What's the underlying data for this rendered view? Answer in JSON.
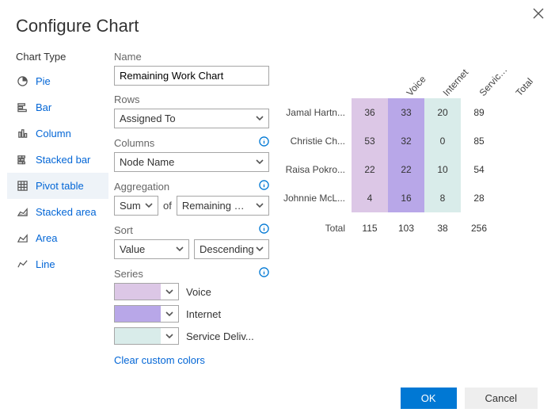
{
  "title": "Configure Chart",
  "sidebar": {
    "label": "Chart Type",
    "items": [
      {
        "label": "Pie"
      },
      {
        "label": "Bar"
      },
      {
        "label": "Column"
      },
      {
        "label": "Stacked bar"
      },
      {
        "label": "Pivot table"
      },
      {
        "label": "Stacked area"
      },
      {
        "label": "Area"
      },
      {
        "label": "Line"
      }
    ],
    "active": 4
  },
  "form": {
    "name_label": "Name",
    "name_value": "Remaining Work Chart",
    "rows_label": "Rows",
    "rows_value": "Assigned To",
    "columns_label": "Columns",
    "columns_value": "Node Name",
    "agg_label": "Aggregation",
    "agg_value": "Sum",
    "agg_of": "of",
    "agg_field": "Remaining Work",
    "sort_label": "Sort",
    "sort_field": "Value",
    "sort_order": "Descending",
    "series_label": "Series",
    "series": [
      {
        "label": "Voice",
        "color": "#dcc7e6"
      },
      {
        "label": "Internet",
        "color": "#b8a7e8"
      },
      {
        "label": "Service Deliv...",
        "color": "#d9ecea"
      }
    ],
    "clear_link": "Clear custom colors"
  },
  "chart_data": {
    "type": "table",
    "title": "Remaining Work Chart",
    "row_field": "Assigned To",
    "column_field": "Node Name",
    "aggregation": "Sum of Remaining Work",
    "columns": [
      "Voice",
      "Internet",
      "Service Del...",
      "Total"
    ],
    "column_colors": [
      "#dcc7e6",
      "#b8a7e8",
      "#d9ecea",
      null
    ],
    "rows": [
      {
        "label": "Jamal Hartn...",
        "values": [
          36,
          33,
          20,
          89
        ]
      },
      {
        "label": "Christie Ch...",
        "values": [
          53,
          32,
          0,
          85
        ]
      },
      {
        "label": "Raisa Pokro...",
        "values": [
          22,
          22,
          10,
          54
        ]
      },
      {
        "label": "Johnnie McL...",
        "values": [
          4,
          16,
          8,
          28
        ]
      }
    ],
    "totals": {
      "label": "Total",
      "values": [
        115,
        103,
        38,
        256
      ]
    }
  },
  "buttons": {
    "ok": "OK",
    "cancel": "Cancel"
  }
}
